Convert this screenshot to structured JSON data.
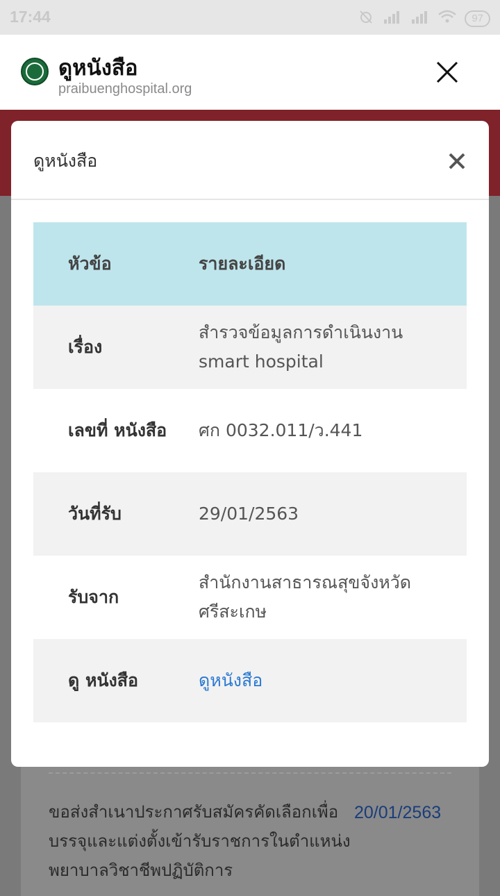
{
  "status_bar": {
    "time": "17:44",
    "battery": "97"
  },
  "browser": {
    "title": "ดูหนังสือ",
    "url": "praibuenghospital.org"
  },
  "modal": {
    "title": "ดูหนังสือ",
    "table": {
      "headers": [
        "หัวข้อ",
        "รายละเอียด"
      ],
      "rows": [
        {
          "label": "เรื่อง",
          "value": "สำรวจข้อมูลการดำเนินงาน smart hospital"
        },
        {
          "label": "เลขที่ หนังสือ",
          "value": "ศก 0032.011/ว.441"
        },
        {
          "label": "วันที่รับ",
          "value": "29/01/2563"
        },
        {
          "label": "รับจาก",
          "value": "สำนักงานสาธารณสุขจังหวัดศรีสะเกษ"
        },
        {
          "label": "ดู หนังสือ",
          "link": "ดูหนังสือ"
        }
      ]
    }
  },
  "background": {
    "item_text": "ขอส่งสำเนาประกาศรับสมัครคัดเลือกเพื่อบรรจุและแต่งตั้งเข้ารับราชการในตำแหน่งพยาบาลวิชาชีพปฏิบัติการ",
    "item_date": "20/01/2563"
  },
  "colors": {
    "modal_header_row": "#bfe5ec",
    "band": "#7f2229",
    "link": "#2a7ad2",
    "alt_row": "#f2f2f2"
  }
}
